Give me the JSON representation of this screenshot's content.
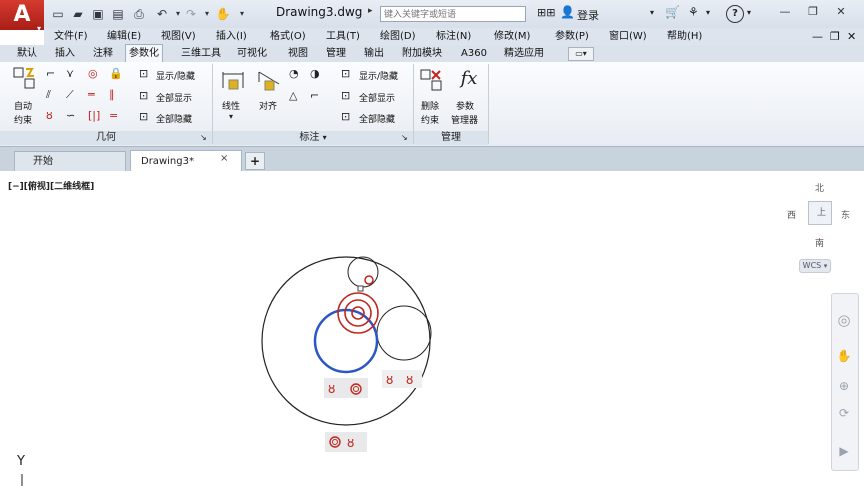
{
  "titlebar": {
    "app_letter": "A",
    "document_title": "Drawing3.dwg",
    "search_placeholder": "键入关键字或短语",
    "login_label": "登录",
    "help_label": "?"
  },
  "menu": [
    "文件(F)",
    "编辑(E)",
    "视图(V)",
    "插入(I)",
    "格式(O)",
    "工具(T)",
    "绘图(D)",
    "标注(N)",
    "修改(M)",
    "参数(P)",
    "窗口(W)",
    "帮助(H)"
  ],
  "ribbon_tabs": [
    "默认",
    "插入",
    "注释",
    "参数化",
    "三维工具",
    "可视化",
    "视图",
    "管理",
    "输出",
    "附加模块",
    "A360",
    "精选应用"
  ],
  "active_ribbon_tab": "参数化",
  "ribbon": {
    "geometry": {
      "auto_constrain": [
        "自动",
        "约束"
      ],
      "panel_title": "几何",
      "show_hide": "显示/隐藏",
      "show_all": "全部显示",
      "hide_all": "全部隐藏"
    },
    "dimensional": {
      "linear": "线性",
      "aligned": "对齐",
      "panel_title": "标注",
      "show_hide": "显示/隐藏",
      "show_all": "全部显示",
      "hide_all": "全部隐藏"
    },
    "manage": {
      "delete_constraints": [
        "删除",
        "约束"
      ],
      "parameters_manager": [
        "参数",
        "管理器"
      ],
      "fx": "fx",
      "panel_title": "管理"
    }
  },
  "file_tabs": {
    "start": "开始",
    "drawing": "Drawing3*",
    "close": "×",
    "new": "+"
  },
  "viewport_label": "[−][俯视][二维线框]",
  "viewcube": {
    "north": "北",
    "south": "南",
    "east": "东",
    "west": "西",
    "wcs": "WCS"
  },
  "ucs": {
    "y_label": "Y"
  },
  "colors": {
    "accent_red": "#c0271d",
    "selected_blue": "#2a56c6",
    "ribbon_bg": "#e8edf3"
  }
}
